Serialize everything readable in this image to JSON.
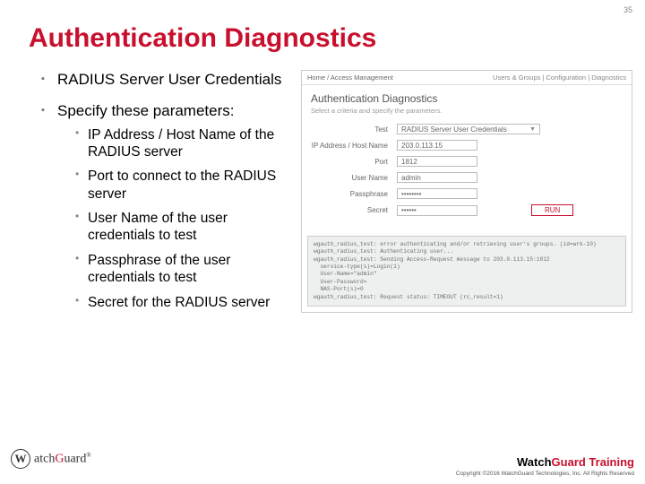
{
  "page_number": "35",
  "title": "Authentication Diagnostics",
  "bullets": {
    "b1": "RADIUS Server User Credentials",
    "b2": "Specify these parameters:",
    "sub": {
      "s1": "IP Address / Host Name of the RADIUS server",
      "s2": "Port to connect to the RADIUS server",
      "s3": "User Name of the user credentials to test",
      "s4": "Passphrase of the user credentials to test",
      "s5": "Secret for the RADIUS server"
    }
  },
  "panel": {
    "breadcrumb_left": "Home / Access Management",
    "breadcrumb_right": "Users & Groups | Configuration | Diagnostics",
    "heading": "Authentication Diagnostics",
    "subheading": "Select a criteria and specify the parameters.",
    "labels": {
      "test": "Test",
      "ip": "IP Address / Host Name",
      "port": "Port",
      "user": "User Name",
      "pass": "Passphrase",
      "secret": "Secret"
    },
    "values": {
      "test": "RADIUS Server User Credentials",
      "ip": "203.0.113.15",
      "port": "1812",
      "user": "admin",
      "pass": "••••••••",
      "secret": "••••••"
    },
    "run": "RUN",
    "log": "wgauth_radius_test: error authenticating and/or retrieving user's groups. (id=wrk-10)\nwgauth_radius_test: Authenticating user...\nwgauth_radius_test: Sending Access-Request message to 203.0.113.15:1812\n  service-type(s)=Login(1)\n  User-Name=\"admin\"\n  User-Password=\n  NAS-Port(s)=0\nwgauth_radius_test: Request status: TIMEOUT (rc_result=1)"
  },
  "footer": {
    "logo_text_pre": "atch",
    "logo_text_g": "G",
    "logo_text_post": "uard",
    "training_pre": "Watch",
    "training_g": "Guard Training",
    "copyright": "Copyright ©2016 WatchGuard Technologies, Inc. All Rights Reserved"
  }
}
